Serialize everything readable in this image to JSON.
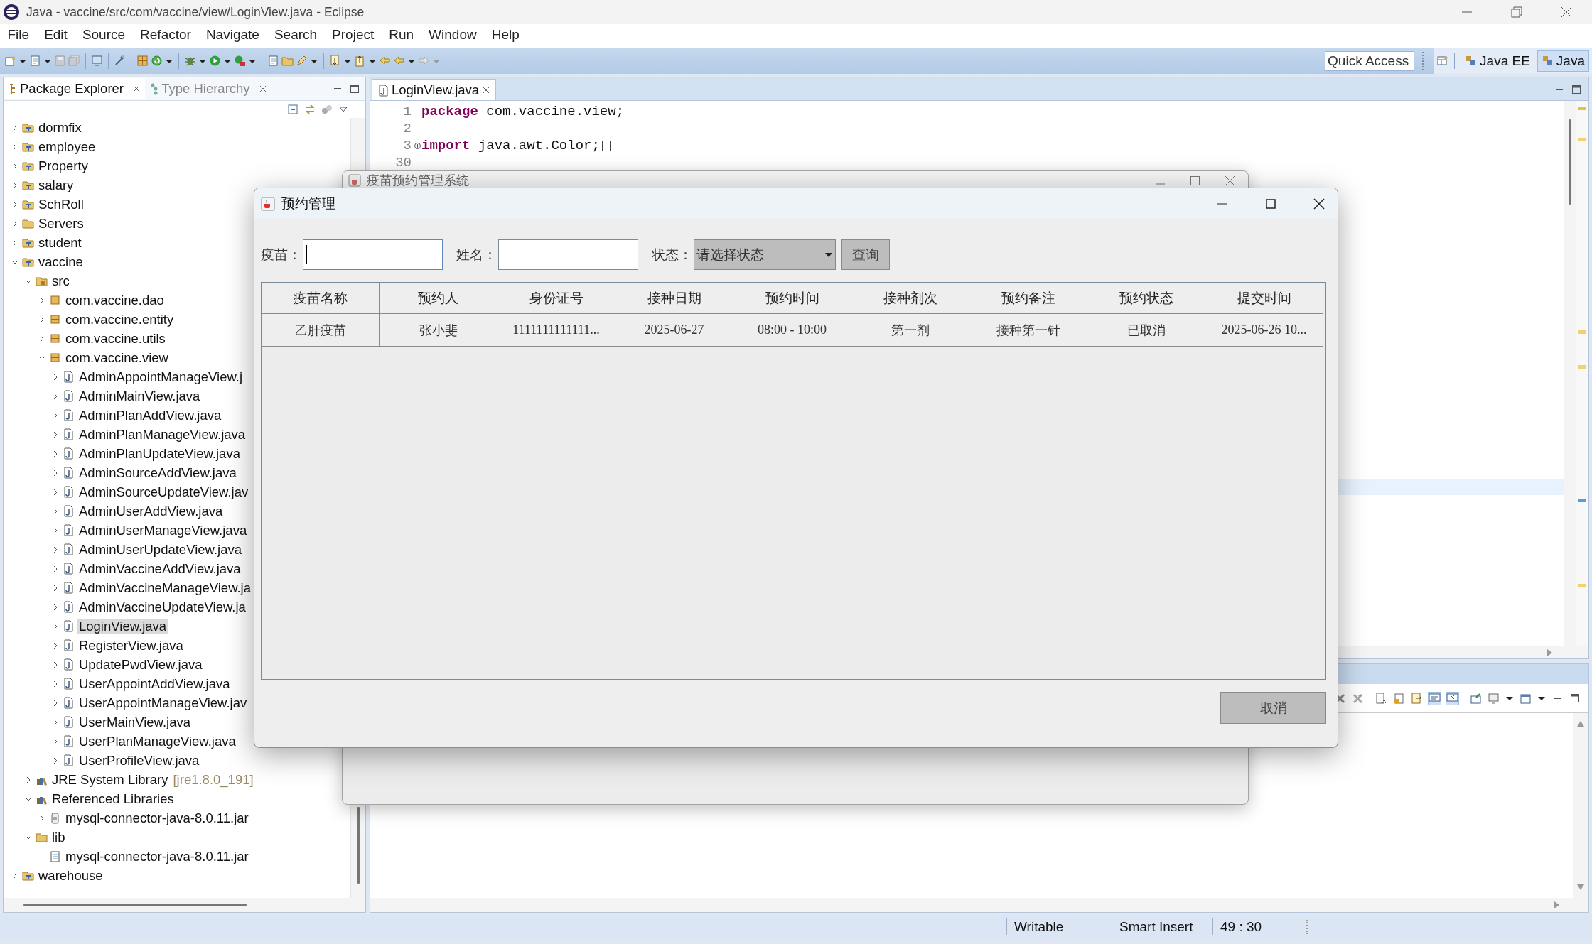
{
  "window": {
    "title": "Java - vaccine/src/com/vaccine/view/LoginView.java - Eclipse"
  },
  "menu": [
    "File",
    "Edit",
    "Source",
    "Refactor",
    "Navigate",
    "Search",
    "Project",
    "Run",
    "Window",
    "Help"
  ],
  "toolbar": {
    "quick_access": {
      "placeholder": "Quick Access"
    },
    "perspectives": [
      {
        "label": "Java EE",
        "selected": false
      },
      {
        "label": "Java",
        "selected": true
      }
    ]
  },
  "package_explorer": {
    "tabs": [
      {
        "label": "Package Explorer",
        "selected": true
      },
      {
        "label": "Type Hierarchy",
        "selected": false
      }
    ],
    "tree": [
      {
        "label": "dormfix",
        "kind": "project",
        "expanded": false,
        "selected": false
      },
      {
        "label": "employee",
        "kind": "project",
        "expanded": false,
        "selected": false
      },
      {
        "label": "Property",
        "kind": "project",
        "expanded": false,
        "selected": false
      },
      {
        "label": "salary",
        "kind": "project",
        "expanded": false,
        "selected": false
      },
      {
        "label": "SchRoll",
        "kind": "project",
        "expanded": false,
        "selected": false
      },
      {
        "label": "Servers",
        "kind": "folder",
        "expanded": false,
        "selected": false
      },
      {
        "label": "student",
        "kind": "project",
        "expanded": false,
        "selected": false
      },
      {
        "label": "vaccine",
        "kind": "project",
        "expanded": true,
        "selected": false,
        "children": [
          {
            "label": "src",
            "kind": "source",
            "expanded": true,
            "selected": false,
            "children": [
              {
                "label": "com.vaccine.dao",
                "kind": "package",
                "expanded": false,
                "selected": false
              },
              {
                "label": "com.vaccine.entity",
                "kind": "package",
                "expanded": false,
                "selected": false
              },
              {
                "label": "com.vaccine.utils",
                "kind": "package",
                "expanded": false,
                "selected": false
              },
              {
                "label": "com.vaccine.view",
                "kind": "package",
                "expanded": true,
                "selected": false,
                "children": [
                  {
                    "label": "AdminAppointManageView.j",
                    "kind": "java",
                    "expanded": false,
                    "selected": false
                  },
                  {
                    "label": "AdminMainView.java",
                    "kind": "java",
                    "expanded": false,
                    "selected": false
                  },
                  {
                    "label": "AdminPlanAddView.java",
                    "kind": "java",
                    "expanded": false,
                    "selected": false
                  },
                  {
                    "label": "AdminPlanManageView.java",
                    "kind": "java",
                    "expanded": false,
                    "selected": false
                  },
                  {
                    "label": "AdminPlanUpdateView.java",
                    "kind": "java",
                    "expanded": false,
                    "selected": false
                  },
                  {
                    "label": "AdminSourceAddView.java",
                    "kind": "java",
                    "expanded": false,
                    "selected": false
                  },
                  {
                    "label": "AdminSourceUpdateView.jav",
                    "kind": "java",
                    "expanded": false,
                    "selected": false
                  },
                  {
                    "label": "AdminUserAddView.java",
                    "kind": "java",
                    "expanded": false,
                    "selected": false
                  },
                  {
                    "label": "AdminUserManageView.java",
                    "kind": "java",
                    "expanded": false,
                    "selected": false
                  },
                  {
                    "label": "AdminUserUpdateView.java",
                    "kind": "java",
                    "expanded": false,
                    "selected": false
                  },
                  {
                    "label": "AdminVaccineAddView.java",
                    "kind": "java",
                    "expanded": false,
                    "selected": false
                  },
                  {
                    "label": "AdminVaccineManageView.ja",
                    "kind": "java",
                    "expanded": false,
                    "selected": false
                  },
                  {
                    "label": "AdminVaccineUpdateView.ja",
                    "kind": "java",
                    "expanded": false,
                    "selected": false
                  },
                  {
                    "label": "LoginView.java",
                    "kind": "java",
                    "expanded": false,
                    "selected": true
                  },
                  {
                    "label": "RegisterView.java",
                    "kind": "java",
                    "expanded": false,
                    "selected": false
                  },
                  {
                    "label": "UpdatePwdView.java",
                    "kind": "java",
                    "expanded": false,
                    "selected": false
                  },
                  {
                    "label": "UserAppointAddView.java",
                    "kind": "java",
                    "expanded": false,
                    "selected": false
                  },
                  {
                    "label": "UserAppointManageView.jav",
                    "kind": "java",
                    "expanded": false,
                    "selected": false
                  },
                  {
                    "label": "UserMainView.java",
                    "kind": "java",
                    "expanded": false,
                    "selected": false
                  },
                  {
                    "label": "UserPlanManageView.java",
                    "kind": "java",
                    "expanded": false,
                    "selected": false
                  },
                  {
                    "label": "UserProfileView.java",
                    "kind": "java",
                    "expanded": false,
                    "selected": false
                  }
                ]
              }
            ]
          },
          {
            "label": "JRE System Library",
            "suffix": "[jre1.8.0_191]",
            "kind": "library",
            "expanded": false,
            "selected": false
          },
          {
            "label": "Referenced Libraries",
            "kind": "library",
            "expanded": true,
            "selected": false,
            "children": [
              {
                "label": "mysql-connector-java-8.0.11.jar",
                "kind": "archive",
                "expanded": false,
                "selected": false
              }
            ]
          },
          {
            "label": "lib",
            "kind": "folder",
            "expanded": true,
            "selected": false,
            "children": [
              {
                "label": "mysql-connector-java-8.0.11.jar",
                "kind": "jar",
                "selected": false
              }
            ]
          }
        ]
      },
      {
        "label": "warehouse",
        "kind": "project",
        "expanded": false,
        "selected": false
      }
    ]
  },
  "editor": {
    "tabs": [
      {
        "label": "LoginView.java",
        "selected": true
      }
    ],
    "lines": [
      {
        "number": "1",
        "tokens": [
          {
            "text": "package",
            "kind": "keyword"
          },
          {
            "text": " com.vaccine.view;",
            "kind": "plain"
          }
        ]
      },
      {
        "number": "2"
      },
      {
        "number": "3",
        "folded": true,
        "tokens": [
          {
            "text": "import",
            "kind": "keyword"
          },
          {
            "text": " java.awt.Color;",
            "kind": "plain"
          }
        ]
      },
      {
        "number": "30"
      }
    ]
  },
  "background_dialog": {
    "title": "疫苗预约管理系统"
  },
  "dialog": {
    "title": "预约管理",
    "filters": [
      {
        "label": "疫苗：",
        "kind": "text",
        "focused": true
      },
      {
        "label": "姓名：",
        "kind": "text",
        "focused": false
      },
      {
        "label": "状态：",
        "kind": "select",
        "value": "请选择状态"
      }
    ],
    "search_button": "查询",
    "table": {
      "columns": [
        "疫苗名称",
        "预约人",
        "身份证号",
        "接种日期",
        "预约时间",
        "接种剂次",
        "预约备注",
        "预约状态",
        "提交时间"
      ],
      "rows": [
        {
          "cells": [
            "乙肝疫苗",
            "张小斐",
            "1111111111111...",
            "2025-06-27",
            "08:00 - 10:00",
            "第一剂",
            "接种第一针",
            "已取消",
            "2025-06-26 10..."
          ]
        }
      ]
    },
    "cancel_button": "取消"
  },
  "status_bar": [
    "Writable",
    "Smart Insert",
    "49 : 30"
  ]
}
